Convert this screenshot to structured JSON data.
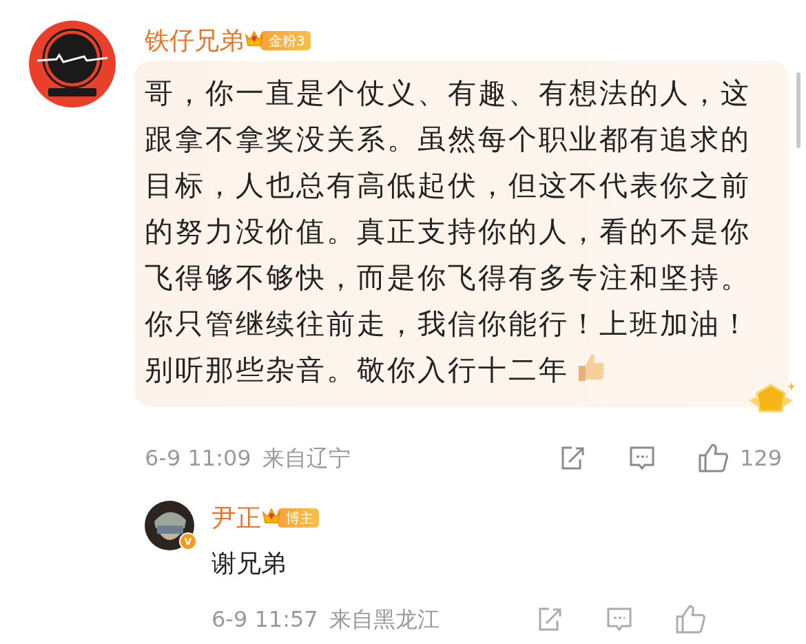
{
  "comment": {
    "author": "铁仔兄弟",
    "badge": "金粉3",
    "text": "哥，你一直是个仗义、有趣、有想法的人，这跟拿不拿奖没关系。虽然每个职业都有追求的目标，人也总有高低起伏，但这不代表你之前的努力没价值。真正支持你的人，看的不是你飞得够不够快，而是你飞得有多专注和坚持。你只管继续往前走，我信你能行！上班加油！别听那些杂音。敬你入行十二年",
    "time": "6-9 11:09",
    "location": "来自辽宁",
    "likes": "129"
  },
  "reply": {
    "author": "尹正",
    "badge": "博主",
    "verified": true,
    "verified_mark": "V",
    "text": "谢兄弟",
    "time": "6-9 11:57",
    "location": "来自黑龙江"
  }
}
